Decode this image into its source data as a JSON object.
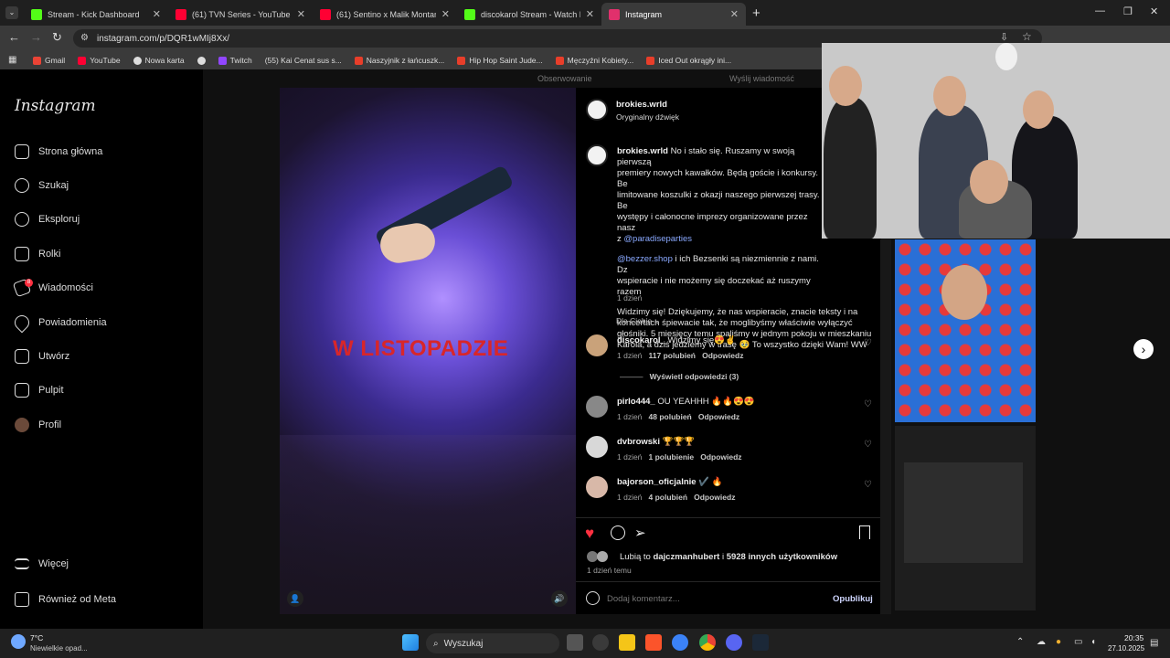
{
  "tabs": [
    {
      "label": "Stream - Kick Dashboard",
      "color": "#53fc18"
    },
    {
      "label": "(61) TVN Series - YouTube",
      "color": "#ff0033"
    },
    {
      "label": "(61) Sentino x Malik Montana -",
      "color": "#ff0033"
    },
    {
      "label": "discokarol Stream - Watch Live",
      "color": "#53fc18"
    },
    {
      "label": "Instagram",
      "color": "#e1306c"
    }
  ],
  "address": "instagram.com/p/DQR1wMIj8Xx/",
  "bookmarks": [
    {
      "label": "Gmail",
      "color": "#ea4335"
    },
    {
      "label": "YouTube",
      "color": "#ff0033"
    },
    {
      "label": "Nowa karta",
      "color": "#dddddd"
    },
    {
      "label": "Twitch",
      "color": "#9146ff"
    },
    {
      "label": "(55) Kai Cenat sus s...",
      "color": "#ff0033"
    },
    {
      "label": "Naszyjnik z łańcuszk...",
      "color": "#e83e2a"
    },
    {
      "label": "Hip Hop Saint Jude...",
      "color": "#e83e2a"
    },
    {
      "label": "Męczyźni Kobiety...",
      "color": "#e83e2a"
    },
    {
      "label": "Iced Out okrągły ini...",
      "color": "#e83e2a"
    }
  ],
  "instagram": {
    "logo": "Instagram",
    "nav": [
      "Strona główna",
      "Szukaj",
      "Eksploruj",
      "Rolki",
      "Wiadomości",
      "Powiadomienia",
      "Utwórz",
      "Pulpit",
      "Profil"
    ],
    "messages_badge": "8",
    "more": "Więcej",
    "meta": "Również od Meta",
    "top_labels": {
      "observed": "Obserwowanie",
      "send": "Wyślij wiadomość"
    }
  },
  "video": {
    "caption": "W LISTOPADZIE"
  },
  "post": {
    "author": "brokies.wrld",
    "audio": "Oryginalny dźwięk",
    "caption_p1": "No i stało się. Ruszamy w swoją pierwszą",
    "caption_p1b": "premiery nowych kawałków. Będą goście i konkursy. Be",
    "caption_p1c": "limitowane koszulki z okazji naszego pierwszej trasy. Be",
    "caption_p1d": "występy i całonocne imprezy organizowane przez nasz",
    "caption_p1e_prefix": "z ",
    "mention1": "@paradiseparties",
    "mention2": "@bezzer.shop",
    "caption_p2": " i ich Bezsenki są niezmiennie z nami. Dz",
    "caption_p2b": "wspieracie i nie możemy się doczekać aż ruszymy razem",
    "caption_p3a": "Widzimy się! Dziękujemy, że nas wspieracie, znacie teksty i na",
    "caption_p3b": "koncertach śpiewacie tak, że moglibyśmy właściwie wyłączyć",
    "caption_p3c": "głośniki. 5 miesięcy temu spaliśmy w jednym pokoju w mieszkaniu",
    "caption_p3d": "Karola, a dziś jedziemy w trasę 🥹  To wszystko dzięki Wam! WW",
    "time": "1 dzień",
    "filter": "Dla Ciebie"
  },
  "comments": [
    {
      "user": "discokarol_",
      "text": "Widzimy się😍✌️",
      "time": "1 dzień",
      "likes": "117 polubień",
      "reply": "Odpowiedz",
      "avatar": "#c9a27a"
    },
    {
      "user": "pirlo444_",
      "text": "OU YEAHHH 🔥🔥😍😍",
      "time": "1 dzień",
      "likes": "48 polubień",
      "reply": "Odpowiedz",
      "avatar": "#888888"
    },
    {
      "user": "dvbrowski",
      "text": "🏆🏆🏆",
      "time": "1 dzień",
      "likes": "1 polubienie",
      "reply": "Odpowiedz",
      "avatar": "#d8d8d8"
    },
    {
      "user": "bajorson_oficjalnie",
      "text": "✔️ 🔥",
      "time": "1 dzień",
      "likes": "4 polubień",
      "reply": "Odpowiedz",
      "avatar": "#d8b8a8"
    }
  ],
  "view_replies": "Wyświetl odpowiedzi (3)",
  "likes_line": {
    "prefix": "Lubią to ",
    "user": "dajczmanhubert",
    "middle": " i ",
    "rest": "5928 innych użytkowników"
  },
  "post_time": "1 dzień temu",
  "add_comment": "Dodaj komentarz...",
  "publish": "Opublikuj",
  "taskbar": {
    "temp": "7°C",
    "weather": "Niewielkie opad...",
    "search": "Wyszukaj",
    "time": "20:35",
    "date": "27.10.2025"
  }
}
